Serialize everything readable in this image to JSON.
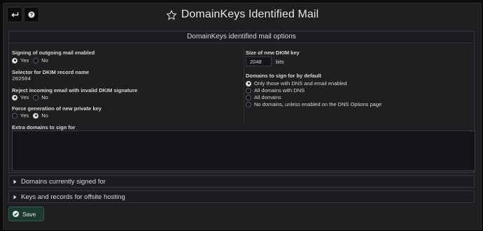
{
  "header": {
    "title": "DomainKeys Identified Mail",
    "back_icon": "back-arrow-icon",
    "help_icon": "help-icon",
    "favorite_icon": "star-icon"
  },
  "options": {
    "section_title": "DomainKeys identified mail options",
    "signing_enabled": {
      "label": "Signing of outgoing mail enabled",
      "options": [
        "Yes",
        "No"
      ],
      "selected": "Yes"
    },
    "selector": {
      "label": "Selector for DKIM record name",
      "value": "202504"
    },
    "reject_invalid": {
      "label": "Reject incoming email with invalid DKIM signature",
      "options": [
        "Yes",
        "No"
      ],
      "selected": "Yes"
    },
    "force_new_key": {
      "label": "Force generation of new private key",
      "options": [
        "Yes",
        "No"
      ],
      "selected": "No"
    },
    "key_size": {
      "label": "Size of new DKIM key",
      "value": "2048",
      "unit": "bits"
    },
    "domains_default": {
      "label": "Domains to sign for by default",
      "options": [
        "Only those with DNS and email enabled",
        "All domains with DNS",
        "All domains",
        "No domains, unless enabled on the DNS Options page"
      ],
      "selected_index": 0
    },
    "extra_domains": {
      "label": "Extra domains to sign for",
      "value": ""
    }
  },
  "sections": {
    "signed_domains": "Domains currently signed for",
    "offsite_keys": "Keys and records for offsite hosting"
  },
  "actions": {
    "save_label": "Save"
  },
  "colors": {
    "background": "#1f1f22",
    "save_button": "#1d3a31",
    "text": "#d8d9da"
  }
}
